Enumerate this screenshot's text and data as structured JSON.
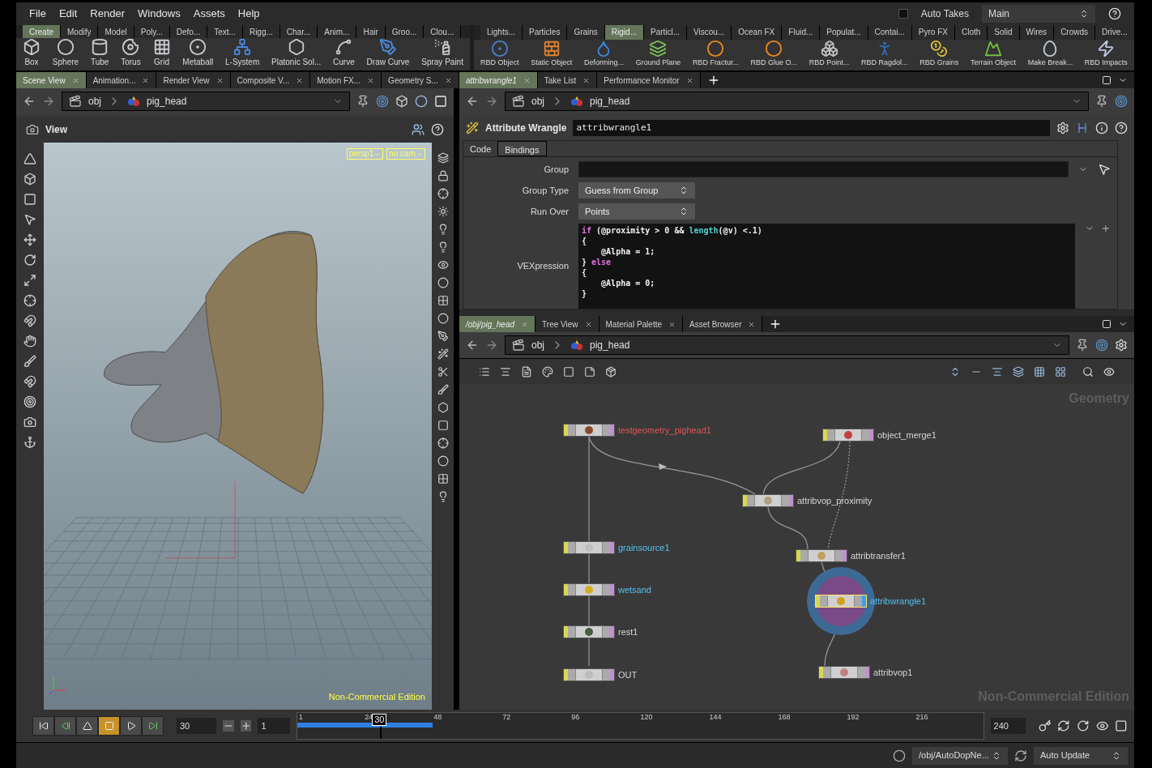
{
  "menu": [
    "File",
    "Edit",
    "Render",
    "Windows",
    "Assets",
    "Help"
  ],
  "auto_takes": {
    "label": "Auto Takes",
    "checked": false
  },
  "take": "Main",
  "shelves": [
    {
      "tabs": [
        {
          "label": "Create",
          "selected": true
        },
        {
          "label": "Modify",
          "selected": false
        },
        {
          "label": "Model",
          "selected": false
        },
        {
          "label": "Poly...",
          "selected": false
        },
        {
          "label": "Defo...",
          "selected": false
        },
        {
          "label": "Text...",
          "selected": false
        },
        {
          "label": "Rigg...",
          "selected": false
        },
        {
          "label": "Char...",
          "selected": false
        },
        {
          "label": "Anim...",
          "selected": false
        },
        {
          "label": "Hair",
          "selected": false
        },
        {
          "label": "Groo...",
          "selected": false
        },
        {
          "label": "Clou...",
          "selected": false
        }
      ],
      "tools": [
        "Box",
        "Sphere",
        "Tube",
        "Torus",
        "Grid",
        "Metaball",
        "L-System",
        "Platonic Sol...",
        "Curve",
        "Draw Curve",
        "Spray Paint"
      ]
    },
    {
      "tabs": [
        {
          "label": "Lights...",
          "selected": false
        },
        {
          "label": "Particles",
          "selected": false
        },
        {
          "label": "Grains",
          "selected": false
        },
        {
          "label": "Rigid...",
          "selected": true
        },
        {
          "label": "Particl...",
          "selected": false
        },
        {
          "label": "Viscou...",
          "selected": false
        },
        {
          "label": "Ocean FX",
          "selected": false
        },
        {
          "label": "Fluid...",
          "selected": false
        },
        {
          "label": "Populat...",
          "selected": false
        },
        {
          "label": "Contai...",
          "selected": false
        },
        {
          "label": "Pyro FX",
          "selected": false
        },
        {
          "label": "Cloth",
          "selected": false
        },
        {
          "label": "Solid",
          "selected": false
        },
        {
          "label": "Wires",
          "selected": false
        },
        {
          "label": "Crowds",
          "selected": false
        },
        {
          "label": "Drive...",
          "selected": false
        }
      ],
      "tools": [
        "RBD Object",
        "Static Object",
        "Deforming...",
        "Ground Plane",
        "RBD Fractur...",
        "RBD Glue O...",
        "RBD Point...",
        "RBD Ragdol...",
        "RBD Grains",
        "Terrain Object",
        "Make Break...",
        "RBD Impacts"
      ]
    }
  ],
  "scene_view": {
    "tabs": [
      {
        "label": "Scene View",
        "selected": true
      },
      {
        "label": "Animation...",
        "selected": false
      },
      {
        "label": "Render View",
        "selected": false
      },
      {
        "label": "Composite V...",
        "selected": false
      },
      {
        "label": "Motion FX...",
        "selected": false
      },
      {
        "label": "Geometry S...",
        "selected": false
      }
    ],
    "path": [
      "obj",
      "pig_head"
    ],
    "title": "View",
    "camera": "persp1",
    "cam": "no cam",
    "watermark": "Non-Commercial Edition"
  },
  "params": {
    "tabs": [
      {
        "label": "attribwrangle1",
        "selected": true
      },
      {
        "label": "Take List",
        "selected": false
      },
      {
        "label": "Performance Monitor",
        "selected": false
      }
    ],
    "path": [
      "obj",
      "pig_head"
    ],
    "node_type": "Attribute Wrangle",
    "node_name": "attribwrangle1",
    "subtabs": [
      {
        "label": "Code",
        "selected": true
      },
      {
        "label": "Bindings",
        "selected": false
      }
    ],
    "fields": [
      {
        "label": "Group",
        "kind": "text"
      },
      {
        "label": "Group Type",
        "kind": "menu",
        "value": "Guess from Group"
      },
      {
        "label": "Run Over",
        "kind": "menu",
        "value": "Points"
      },
      {
        "label": "VEXpression",
        "kind": "code",
        "lines": [
          [
            {
              "text": "if",
              "kind": "keyword"
            },
            {
              "text": " (@proximity > 0 && ",
              "kind": "plain"
            },
            {
              "text": "length",
              "kind": "function"
            },
            {
              "text": "(@v) <.1)",
              "kind": "plain"
            }
          ],
          [
            {
              "text": "{",
              "kind": "plain"
            }
          ],
          [
            {
              "text": "    @Alpha = 1;",
              "kind": "plain"
            }
          ],
          [
            {
              "text": "} ",
              "kind": "plain"
            },
            {
              "text": "else",
              "kind": "keyword"
            }
          ],
          [
            {
              "text": "{",
              "kind": "plain"
            }
          ],
          [
            {
              "text": "    @Alpha = 0;",
              "kind": "plain"
            }
          ],
          [
            {
              "text": "}",
              "kind": "plain"
            }
          ]
        ]
      }
    ]
  },
  "network": {
    "tabs": [
      {
        "label": "/obj/pig_head",
        "selected": true
      },
      {
        "label": "Tree View",
        "selected": false
      },
      {
        "label": "Material Palette",
        "selected": false
      },
      {
        "label": "Asset Browser",
        "selected": false
      }
    ],
    "path": [
      "obj",
      "pig_head"
    ],
    "context": "Geometry",
    "watermark": "Non-Commercial Edition",
    "nodes": [
      {
        "name": "testgeometry_pighead1",
        "color": "#e25656",
        "selected": false
      },
      {
        "name": "object_merge1",
        "color": "#d6d6d6",
        "selected": false
      },
      {
        "name": "attribvop_proximity",
        "color": "#d6d6d6",
        "selected": false
      },
      {
        "name": "grainsource1",
        "color": "#55c2f2",
        "selected": false
      },
      {
        "name": "attribtransfer1",
        "color": "#d6d6d6",
        "selected": false
      },
      {
        "name": "wetsand",
        "color": "#55c2f2",
        "selected": false
      },
      {
        "name": "attribwrangle1",
        "color": "#55c2f2",
        "selected": true
      },
      {
        "name": "rest1",
        "color": "#d6d6d6",
        "selected": false
      },
      {
        "name": "OUT",
        "color": "#d6d6d6",
        "selected": false
      },
      {
        "name": "attribvop1",
        "color": "#d6d6d6",
        "selected": false
      }
    ]
  },
  "timeline": {
    "frame": "30",
    "step": "1",
    "marker": "30",
    "playhead": {
      "level": 0.121
    },
    "cache": {
      "level": 0.197
    },
    "ticks": [
      "1",
      "24",
      "48",
      "72",
      "96",
      "120",
      "144",
      "168",
      "192",
      "216"
    ],
    "end": "240"
  },
  "status": {
    "path": "/obj/AutoDopNe...",
    "update": "Auto Update"
  }
}
